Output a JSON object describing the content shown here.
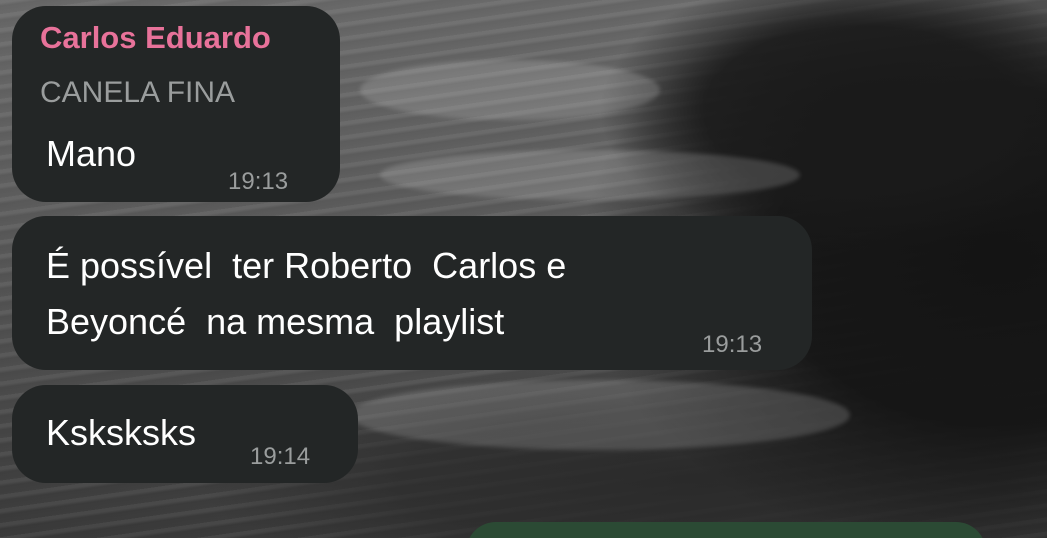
{
  "chat": {
    "messages": [
      {
        "sender": "Carlos Eduardo",
        "sender_subtitle": "CANELA FINA",
        "lines": [
          "Mano"
        ],
        "time": "19:13"
      },
      {
        "lines": [
          "É possível  ter Roberto  Carlos e",
          "Beyoncé  na mesma  playlist"
        ],
        "time": "19:13"
      },
      {
        "lines": [
          "Ksksksks"
        ],
        "time": "19:14"
      }
    ]
  },
  "colors": {
    "incoming_bubble": "#232626",
    "outgoing_bubble": "#2b4a34",
    "sender_name": "#e8729a",
    "secondary_text": "#9a9d9d"
  }
}
